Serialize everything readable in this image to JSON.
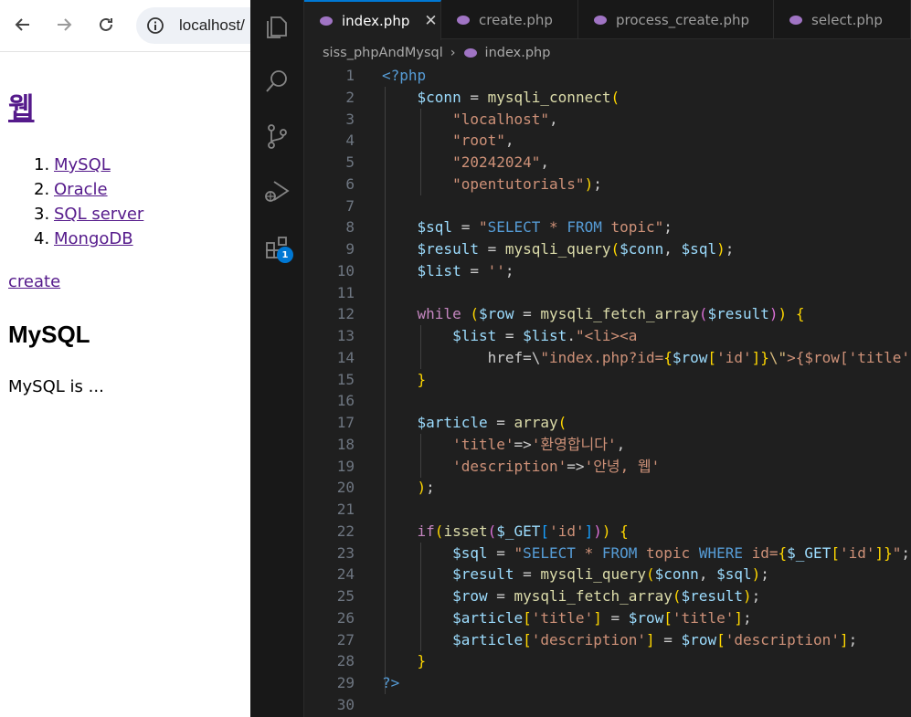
{
  "browser": {
    "url": "localhost/",
    "page": {
      "heading": "웹",
      "list": [
        {
          "num": "1.",
          "label": "MySQL"
        },
        {
          "num": "2.",
          "label": "Oracle"
        },
        {
          "num": "3.",
          "label": "SQL server"
        },
        {
          "num": "4.",
          "label": "MongoDB"
        }
      ],
      "create_link": "create",
      "article_title": "MySQL",
      "article_body": "MySQL is ..."
    }
  },
  "editor": {
    "tabs": [
      {
        "label": "index.php",
        "active": true
      },
      {
        "label": "create.php",
        "active": false
      },
      {
        "label": "process_create.php",
        "active": false
      },
      {
        "label": "select.php",
        "active": false
      }
    ],
    "close_glyph": "✕",
    "breadcrumb": {
      "folder": "siss_phpAndMysql",
      "file": "index.php"
    },
    "extensions_badge": "1",
    "line_numbers": [
      "1",
      "2",
      "3",
      "4",
      "5",
      "6",
      "7",
      "8",
      "9",
      "10",
      "11",
      "12",
      "13",
      "14",
      "15",
      "16",
      "17",
      "18",
      "19",
      "20",
      "21",
      "22",
      "23",
      "24",
      "25",
      "26",
      "27",
      "28",
      "29",
      "30"
    ],
    "code_lines": [
      "<?php",
      "    $conn = mysqli_connect(",
      "        \"localhost\",",
      "        \"root\",",
      "        \"20242024\",",
      "        \"opentutorials\");",
      "",
      "    $sql = \"SELECT * FROM topic\";",
      "    $result = mysqli_query($conn, $sql);",
      "    $list = '';",
      "",
      "    while ($row = mysqli_fetch_array($result)) {",
      "        $list = $list.\"<li><a",
      "            href=\\\"index.php?id={$row['id']}\\\">{$row['title'",
      "    }",
      "",
      "    $article = array(",
      "        'title'=>'환영합니다',",
      "        'description'=>'안녕, 웹'",
      "    );",
      "",
      "    if(isset($_GET['id'])) {",
      "        $sql = \"SELECT * FROM topic WHERE id={$_GET['id']}\";",
      "        $result = mysqli_query($conn, $sql);",
      "        $row = mysqli_fetch_array($result);",
      "        $article['title'] = $row['title'];",
      "        $article['description'] = $row['description'];",
      "    }",
      "?>",
      ""
    ]
  },
  "colors": {
    "editor_bg": "#1f1f1f",
    "activity_bg": "#181818",
    "accent": "#0078d4",
    "visited_link": "#551a8b",
    "variable": "#9cdcfe",
    "function": "#dcdcaa",
    "string": "#ce9178",
    "keyword": "#569cd6",
    "control": "#c586c0"
  },
  "icons": {
    "browser": [
      "back-arrow-icon",
      "forward-arrow-icon",
      "reload-icon",
      "info-icon"
    ],
    "activity_bar": [
      "explorer-icon",
      "search-icon",
      "source-control-icon",
      "run-debug-icon",
      "extensions-icon"
    ],
    "file": "php-elephant-icon"
  }
}
